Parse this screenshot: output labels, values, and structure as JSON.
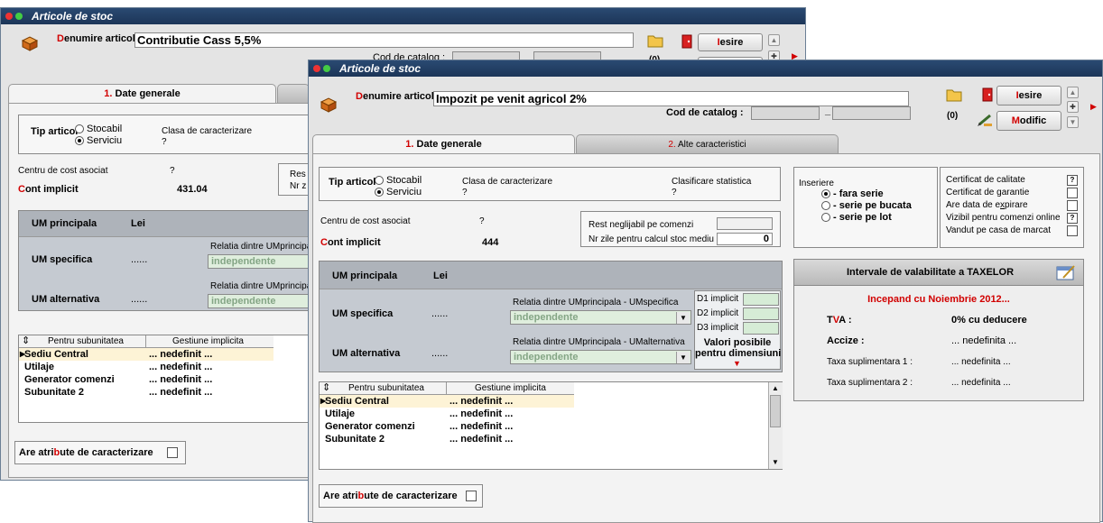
{
  "back_window": {
    "title": "Articole de stoc",
    "denumire_label_first": "D",
    "denumire_label_rest": "enumire articol",
    "denumire_value": "Contributie Cass 5,5%",
    "cod_catalog_label": "Cod de catalog :",
    "count": "(0)",
    "exit_first": "I",
    "exit_rest": "esire",
    "tab1_num": "1.",
    "tab1_label": " Date generale",
    "tip_articol_label": "Tip articol",
    "stocabil_label": "Stocabil",
    "serviciu_label": "Serviciu",
    "clasa_label": "Clasa de caracterizare",
    "clasa_value": "?",
    "centru_label": "Centru de cost asociat",
    "centru_value": "?",
    "cont_first": "C",
    "cont_rest": "ont implicit",
    "cont_value": "431.04",
    "res_partial": "Res",
    "nr_partial": "Nr z",
    "um_principala_label": "UM principala",
    "um_principala_value": "Lei",
    "um_specifica_label": "UM specifica",
    "um_specifica_dots": "......",
    "relatia_spec_label": "Relatia dintre UMprincipal",
    "combo_spec_value": "independente",
    "um_alternativa_label": "UM alternativa",
    "um_alternativa_dots": "......",
    "relatia_alt_label": "Relatia dintre UMprincipal",
    "combo_alt_value": "independente",
    "grid_sort_icon": "⇕",
    "grid_col1": "Pentru subunitatea",
    "grid_col2": "Gestiune implicita",
    "grid_rows": [
      {
        "unit": "Sediu Central",
        "gest": "... nedefinit ..."
      },
      {
        "unit": "Utilaje",
        "gest": "... nedefinit ..."
      },
      {
        "unit": "Generator comenzi",
        "gest": "... nedefinit ..."
      },
      {
        "unit": "Subunitate 2",
        "gest": "... nedefinit ..."
      }
    ],
    "atribute_pre": "Are atri",
    "atribute_red": "b",
    "atribute_post": "ute de caracterizare"
  },
  "front_window": {
    "title": "Articole de stoc",
    "denumire_label_first": "D",
    "denumire_label_rest": "enumire articol",
    "denumire_value": "Impozit pe venit agricol 2%",
    "cod_catalog_label": "Cod de catalog :",
    "cod_catalog_dash": "_",
    "count": "(0)",
    "exit_first": "I",
    "exit_rest": "esire",
    "modific_first": "M",
    "modific_rest": "odific",
    "tab1_num": "1.",
    "tab1_label": " Date generale",
    "tab2_num": "2.",
    "tab2_label": " Alte caracteristici",
    "tip_articol_label": "Tip articol",
    "stocabil_label": "Stocabil",
    "serviciu_label": "Serviciu",
    "clasa_label": "Clasa de caracterizare",
    "clasa_value": "?",
    "clasificare_label": "Clasificare statistica",
    "clasificare_value": "?",
    "centru_label": "Centru de cost asociat",
    "centru_value": "?",
    "cont_first": "C",
    "cont_rest": "ont implicit",
    "cont_value": "444",
    "rest_label": "Rest neglijabil pe comenzi",
    "nr_zile_label": "Nr zile pentru calcul stoc mediu",
    "nr_zile_value": "0",
    "um_principala_label": "UM principala",
    "um_principala_value": "Lei",
    "um_specifica_label": "UM specifica",
    "um_specifica_dots": "......",
    "relatia_spec_label": "Relatia dintre UMprincipala - UMspecifica",
    "combo_spec_value": "independente",
    "um_alternativa_label": "UM alternativa",
    "um_alternativa_dots": "......",
    "relatia_alt_label": "Relatia dintre UMprincipala - UMalternativa",
    "combo_alt_value": "independente",
    "d1_label": "D1 implicit",
    "d2_label": "D2 implicit",
    "d3_label": "D3 implicit",
    "valori_line1": "Valori posibile",
    "valori_line2": "pentru dimensiuni",
    "inserie_label": "Inseriere",
    "fara_serie": "- fara serie",
    "serie_bucata": "- serie pe bucata",
    "serie_lot": "- serie pe lot",
    "cert_calitate": "Certificat de calitate",
    "cert_calitate_mark": "?",
    "cert_garantie": "Certificat de garantie",
    "data_expirare_pre": "Are data de e",
    "data_expirare_u": "x",
    "data_expirare_post": "pirare",
    "vizibil_online": "Vizibil pentru comenzi online",
    "vizibil_mark": "?",
    "vandut_casa": "Vandut pe casa de marcat",
    "taxe_header": "Intervale de valabilitate a TAXELOR",
    "incepand": "Incepand cu Noiembrie 2012...",
    "tva_pre": "T",
    "tva_u": "V",
    "tva_post": "A :",
    "tva_value": "0% cu deducere",
    "accize_pre": "Accize :",
    "accize_value": "... nedefinita ...",
    "taxa1_label": "Taxa suplimentara 1 :",
    "taxa1_value": "... nedefinita ...",
    "taxa2_label": "Taxa suplimentara 2 :",
    "taxa2_value": "... nedefinita ...",
    "grid_sort_icon": "⇕",
    "grid_col1": "Pentru subunitatea",
    "grid_col2": "Gestiune implicita",
    "grid_rows": [
      {
        "unit": "Sediu Central",
        "gest": "... nedefinit ..."
      },
      {
        "unit": "Utilaje",
        "gest": "... nedefinit ..."
      },
      {
        "unit": "Generator comenzi",
        "gest": "... nedefinit ..."
      },
      {
        "unit": "Subunitate 2",
        "gest": "... nedefinit ..."
      }
    ],
    "atribute_pre": "Are atri",
    "atribute_red": "b",
    "atribute_post": "ute de caracterizare"
  },
  "colors": {
    "title_bar": "#1c3558",
    "accent_red": "#d10000",
    "combo_green": "#dfeedd",
    "selected_row": "#fdf3d6"
  },
  "icons": [
    "box-icon",
    "folder-icon",
    "exit-door-icon",
    "modify-pen-icon",
    "nav-up-icon",
    "nav-cross-icon",
    "nav-down-icon",
    "calendar-edit-icon",
    "dropdown-arrow-icon",
    "scroll-up-icon",
    "scroll-down-icon",
    "red-triangle-icon"
  ]
}
